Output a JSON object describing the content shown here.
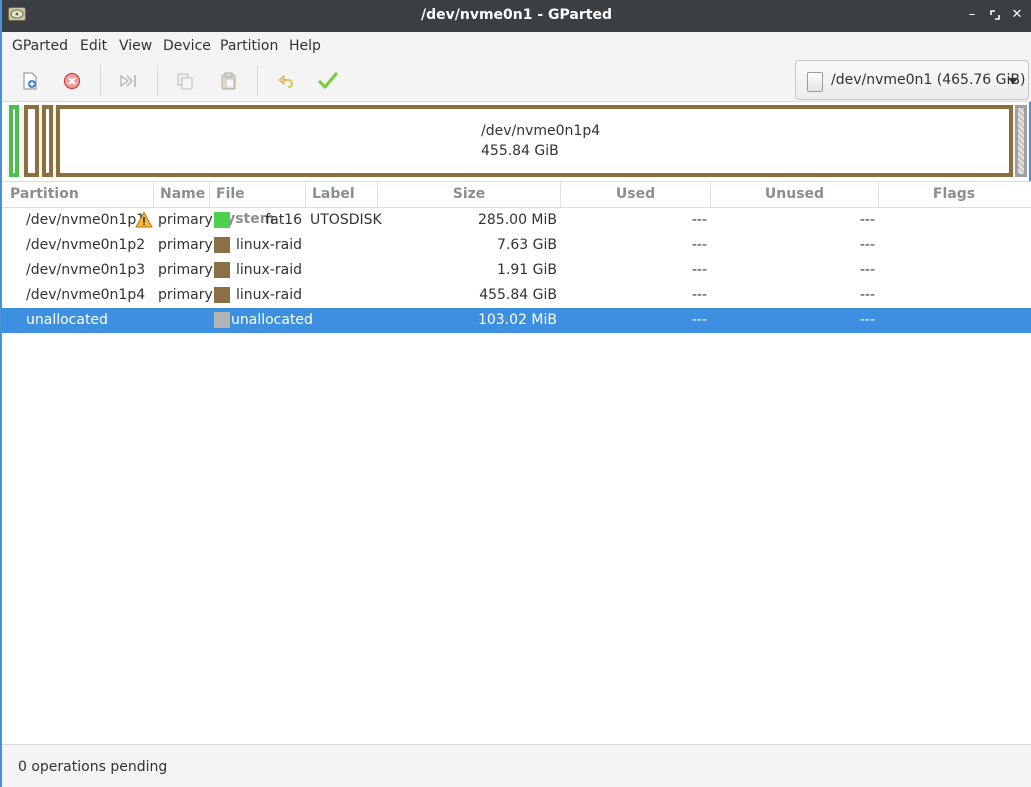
{
  "window": {
    "title": "/dev/nvme0n1 - GParted"
  },
  "menubar": {
    "items": [
      "GParted",
      "Edit",
      "View",
      "Device",
      "Partition",
      "Help"
    ]
  },
  "toolbar": {
    "buttons": [
      "new-icon",
      "delete-icon",
      "resize-move-icon",
      "copy-icon",
      "paste-icon",
      "undo-icon",
      "apply-icon"
    ],
    "device_selector": "/dev/nvme0n1 (465.76 GiB)"
  },
  "disk_map": {
    "selected_partition": "/dev/nvme0n1p4",
    "selected_size": "455.84 GiB"
  },
  "table": {
    "columns": [
      "Partition",
      "Name",
      "File System",
      "Label",
      "Size",
      "Used",
      "Unused",
      "Flags"
    ],
    "rows": [
      {
        "partition": "/dev/nvme0n1p1",
        "name": "primary",
        "filesystem": "fat16",
        "fs_color": "#4dd24d",
        "label": "UTOSDISK",
        "size": "285.00 MiB",
        "used": "---",
        "unused": "---",
        "flags": "",
        "warning": true
      },
      {
        "partition": "/dev/nvme0n1p2",
        "name": "primary",
        "filesystem": "linux-raid",
        "fs_color": "#8b6f47",
        "label": "",
        "size": "7.63 GiB",
        "used": "---",
        "unused": "---",
        "flags": ""
      },
      {
        "partition": "/dev/nvme0n1p3",
        "name": "primary",
        "filesystem": "linux-raid",
        "fs_color": "#8b6f47",
        "label": "",
        "size": "1.91 GiB",
        "used": "---",
        "unused": "---",
        "flags": ""
      },
      {
        "partition": "/dev/nvme0n1p4",
        "name": "primary",
        "filesystem": "linux-raid",
        "fs_color": "#8b6f47",
        "label": "",
        "size": "455.84 GiB",
        "used": "---",
        "unused": "---",
        "flags": ""
      },
      {
        "partition": "unallocated",
        "name": "",
        "filesystem": "unallocated",
        "fs_color": "#b4b4b4",
        "label": "",
        "size": "103.02 MiB",
        "used": "---",
        "unused": "---",
        "flags": "",
        "selected": true
      }
    ]
  },
  "status": {
    "text": "0 operations pending"
  },
  "colors": {
    "selection": "#3d8fe0",
    "titlebar": "#3a3f44",
    "raid_border": "#8b6f3e",
    "fat16_border": "#4dbd4d"
  }
}
